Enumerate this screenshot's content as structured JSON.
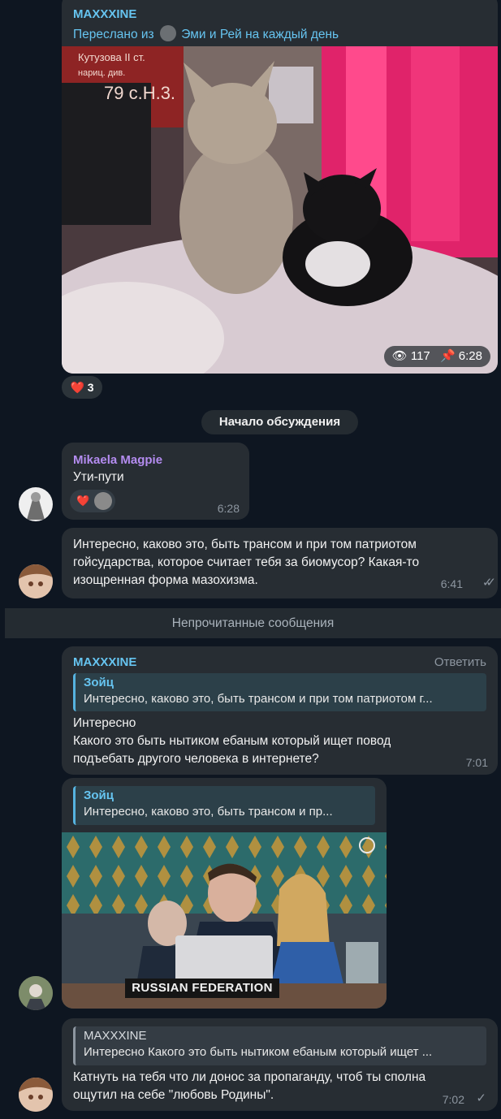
{
  "msg1": {
    "sender": "MAXXXINE",
    "forwarded_prefix": "Переслано из",
    "forwarded_channel": "Эми и Рей на каждый день",
    "views": "117",
    "time": "6:28",
    "reaction_emoji": "❤️",
    "reaction_count": "3"
  },
  "discussion_label": "Начало обсуждения",
  "msg2": {
    "sender": "Mikaela Magpie",
    "text": "Ути-пути",
    "time": "6:28",
    "reaction_emoji": "❤️"
  },
  "msg3": {
    "lines": [
      "Интересно, каково это, быть трансом и при том патриотом",
      "гойсударства, которое считает тебя за биомусор? Какая-то",
      "изощренная форма мазохизма."
    ],
    "time": "6:41"
  },
  "unread_label": "Непрочитанные сообщения",
  "msg4": {
    "sender": "MAXXXINE",
    "reply_action": "Ответить",
    "quote_name": "Зойц",
    "quote_text": "Интересно, каково это, быть трансом и при том патриотом г...",
    "lines": [
      "Интересно",
      "Какого это быть нытиком ебаным который ищет повод",
      "подъебать другого человека в интернете?"
    ],
    "time": "7:01"
  },
  "msg5": {
    "quote_name": "Зойц",
    "quote_text": "Интересно, каково это, быть трансом и пр...",
    "nameplate": "RUSSIAN FEDERATION"
  },
  "msg6": {
    "quote_name": "MAXXXINE",
    "quote_text": "Интересно  Какого это быть нытиком ебаным который ищет ...",
    "lines": [
      "Катнуть на тебя что ли донос за пропаганду, чтоб ты сполна",
      "ощутил на себе \"любовь Родины\"."
    ],
    "time": "7:02"
  },
  "colors": {
    "background": "#0e1621",
    "bubble": "#272d33",
    "accent_blue": "#66c4f0",
    "accent_purple": "#b48cf0",
    "heart": "#e0245e"
  }
}
